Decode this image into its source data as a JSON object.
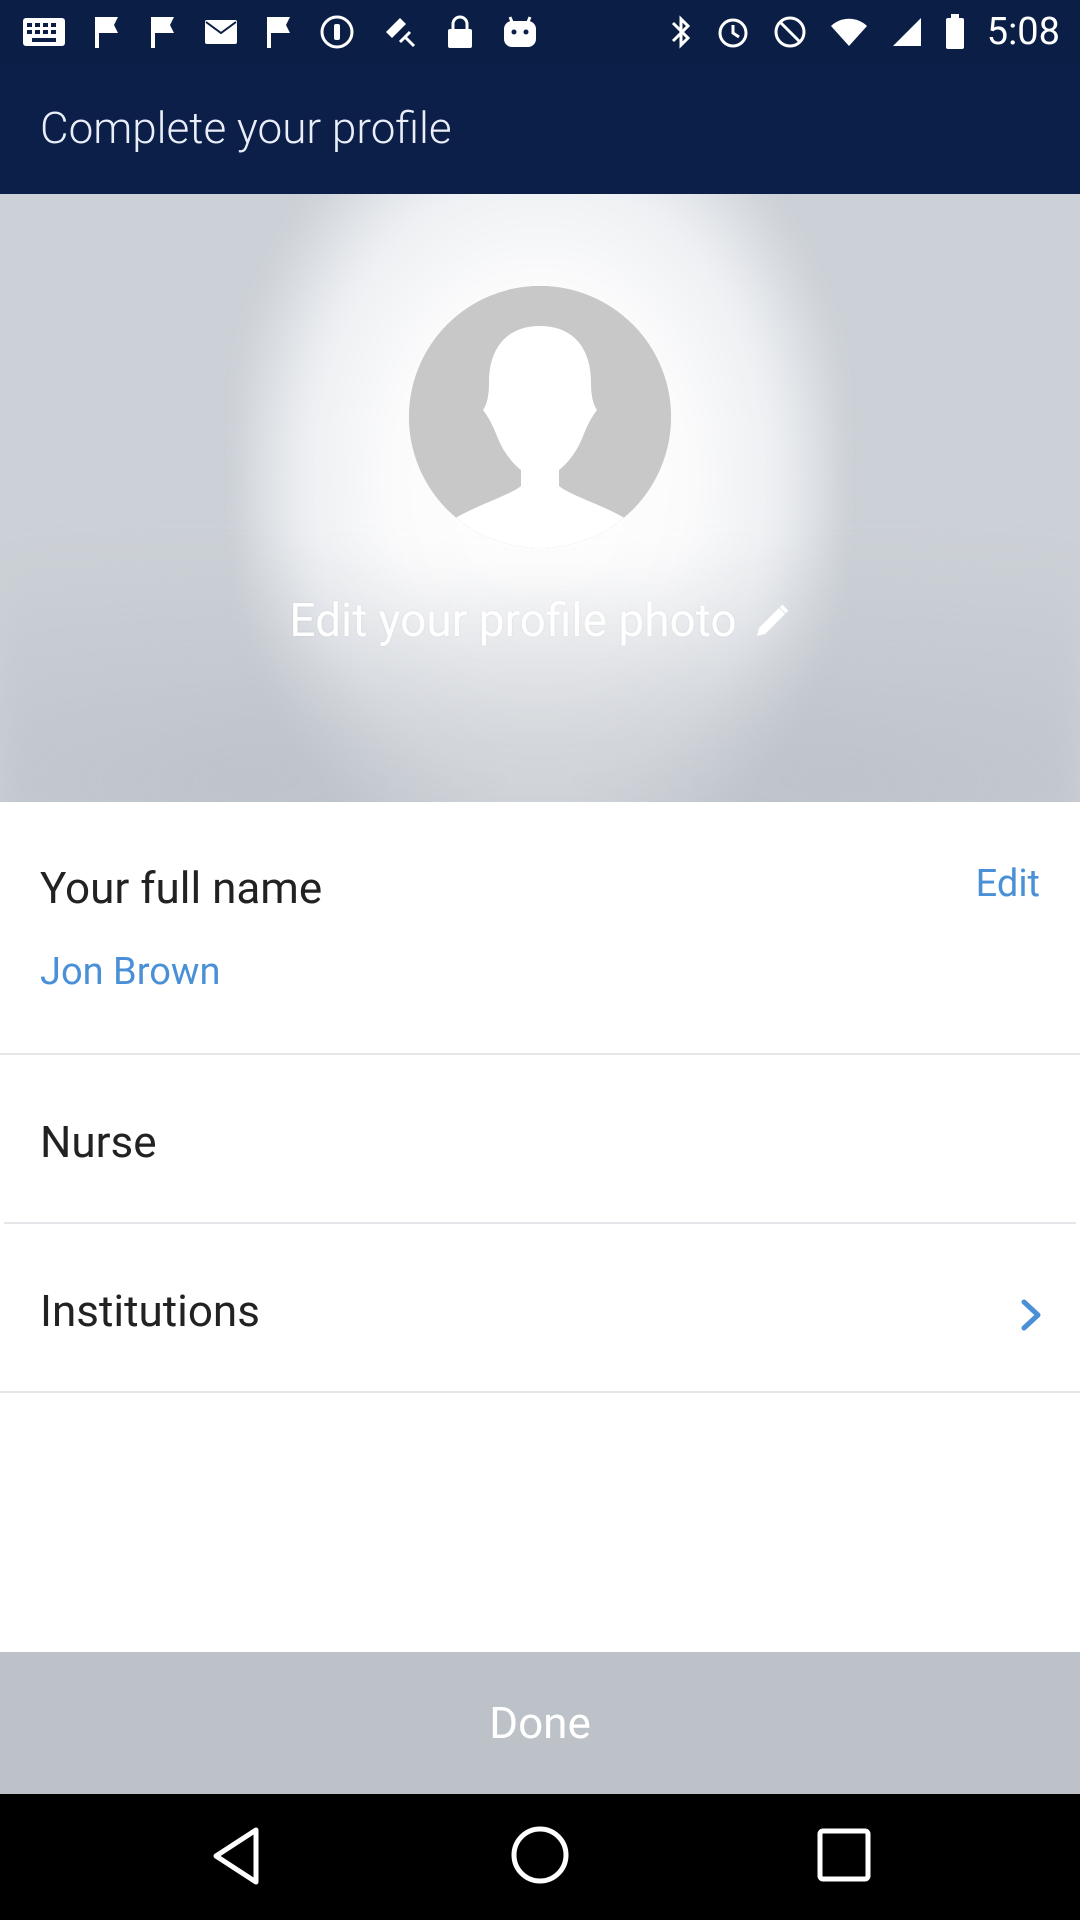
{
  "status_bar": {
    "time": "5:08",
    "icons_left": [
      "keyboard-icon",
      "flag-icon",
      "flag-icon",
      "mail-icon",
      "flag-icon",
      "signal-app-icon",
      "gps-icon",
      "lock-icon",
      "robot-icon"
    ],
    "icons_right": [
      "bluetooth-icon",
      "alarm-icon",
      "silent-icon",
      "wifi-icon",
      "cellular-icon",
      "battery-icon"
    ]
  },
  "app_bar": {
    "title": "Complete your profile"
  },
  "photo": {
    "edit_label": "Edit your profile photo"
  },
  "profile": {
    "name_label": "Your full name",
    "edit_label": "Edit",
    "name_value": "Jon Brown",
    "profession": "Nurse",
    "institutions_label": "Institutions"
  },
  "footer": {
    "done_label": "Done"
  },
  "colors": {
    "app_bar": "#0c1f48",
    "accent": "#4a90d6",
    "done_bg": "#bdc2c9"
  }
}
